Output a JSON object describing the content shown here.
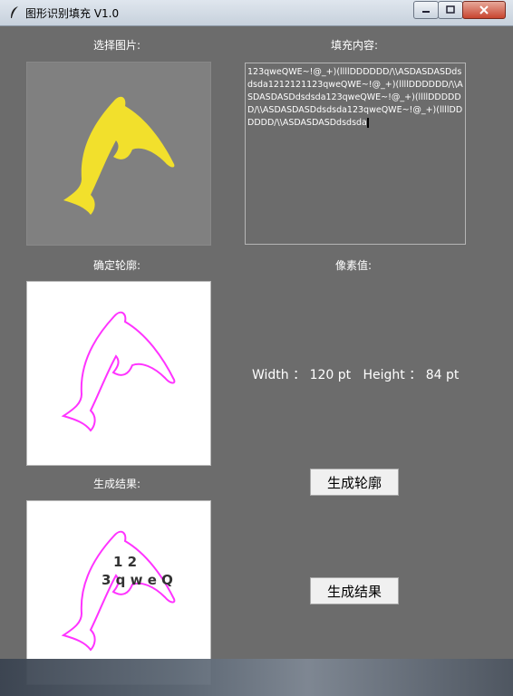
{
  "window": {
    "title": "图形识别填充 V1.0"
  },
  "labels": {
    "select_image": "选择图片:",
    "fill_content": "填充内容:",
    "contour": "确定轮廓:",
    "pixel_value": "像素值:",
    "result": "生成结果:"
  },
  "fill_text": "123qweQWE~!@_+)(llllDDDDDD/\\\\ASDASDASDdsdsda1212121123qweQWE~!@_+)(llllDDDDDD/\\\\ASDASDASDdsdsda123qweQWE~!@_+)(llllDDDDDD/\\\\ASDASDASDdsdsda123qweQWE~!@_+)(llllDDDDDD/\\\\ASDASDASDdsdsda",
  "dimensions": {
    "width_label": "Width",
    "width_value": "120 pt",
    "height_label": "Height",
    "height_value": "84 pt",
    "colon": "："
  },
  "buttons": {
    "generate_contour": "生成轮廓",
    "generate_result": "生成结果"
  },
  "result_text": {
    "line1": "1 2",
    "line2": "3 q w e Q"
  },
  "colors": {
    "dolphin_fill": "#f2e02c",
    "contour": "#ff33ff",
    "background": "#6c6c6c"
  }
}
